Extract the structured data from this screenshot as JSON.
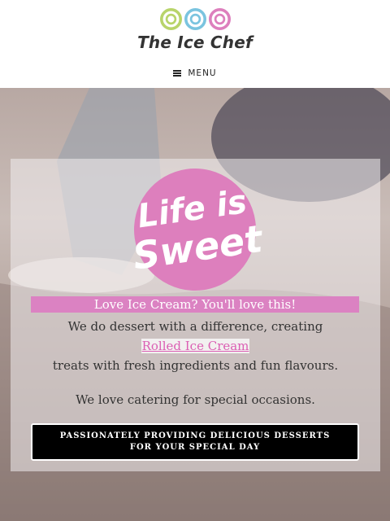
{
  "brand": {
    "name": "The Ice Chef",
    "swirl_colors": [
      "#b8d46a",
      "#7ac4df",
      "#dd7fbd"
    ]
  },
  "nav": {
    "menu_label": "MENU"
  },
  "hero": {
    "badge_line1": "Life is",
    "badge_line2": "Sweet",
    "tagline": "Love Ice Cream? You'll love this!",
    "text_line1": "We do dessert with a difference, creating",
    "link_text": "Rolled Ice Cream",
    "text_line3": "treats with fresh ingredients and fun flavours.",
    "text_line4": "We love catering for special occasions.",
    "cta_label": "PASSIONATELY PROVIDING DELICIOUS DESSERTS FOR YOUR SPECIAL DAY"
  },
  "colors": {
    "accent_pink": "#db82c2",
    "button_bg": "#000000"
  }
}
